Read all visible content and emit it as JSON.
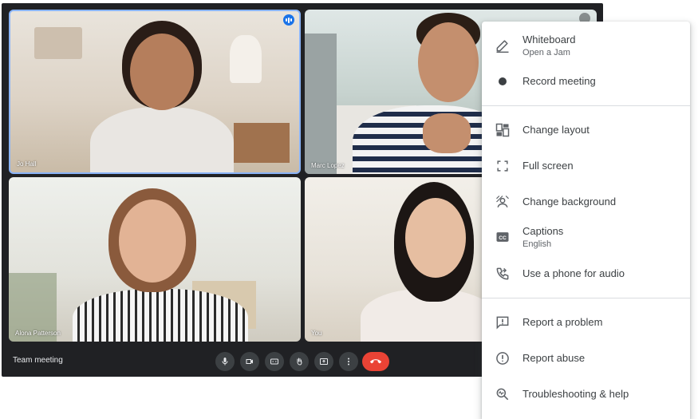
{
  "participants": [
    {
      "name": "Jo Hall",
      "speaking": true
    },
    {
      "name": "Marc Lopez",
      "speaking": false
    },
    {
      "name": "Alona Patterson",
      "speaking": false
    },
    {
      "name": "You",
      "speaking": false
    }
  ],
  "bottom_bar": {
    "meeting_name": "Team meeting",
    "controls": [
      "mic-icon",
      "camera-icon",
      "captions-icon",
      "raise-hand-icon",
      "present-icon",
      "more-options-icon",
      "end-call-icon"
    ]
  },
  "menu": {
    "items": [
      {
        "label": "Whiteboard",
        "sub": "Open a Jam",
        "icon": "pencil-icon"
      },
      {
        "label": "Record meeting",
        "sub": "",
        "icon": "record-icon"
      },
      {
        "label": "Change layout",
        "sub": "",
        "icon": "layout-icon"
      },
      {
        "label": "Full screen",
        "sub": "",
        "icon": "fullscreen-icon"
      },
      {
        "label": "Change background",
        "sub": "",
        "icon": "background-icon"
      },
      {
        "label": "Captions",
        "sub": "English",
        "icon": "captions-icon"
      },
      {
        "label": "Use a phone for audio",
        "sub": "",
        "icon": "phone-icon"
      },
      {
        "label": "Report a problem",
        "sub": "",
        "icon": "report-problem-icon"
      },
      {
        "label": "Report abuse",
        "sub": "",
        "icon": "report-abuse-icon"
      },
      {
        "label": "Troubleshooting & help",
        "sub": "",
        "icon": "troubleshoot-icon"
      }
    ]
  },
  "colors": {
    "stage_bg": "#202124",
    "control_bg": "#3c4043",
    "end_call": "#ea4335",
    "speaking_accent": "#1a73e8",
    "active_border": "#8ab4f8",
    "menu_text": "#3c4043",
    "menu_subtext": "#5f6368",
    "icon_color": "#5f6368"
  }
}
